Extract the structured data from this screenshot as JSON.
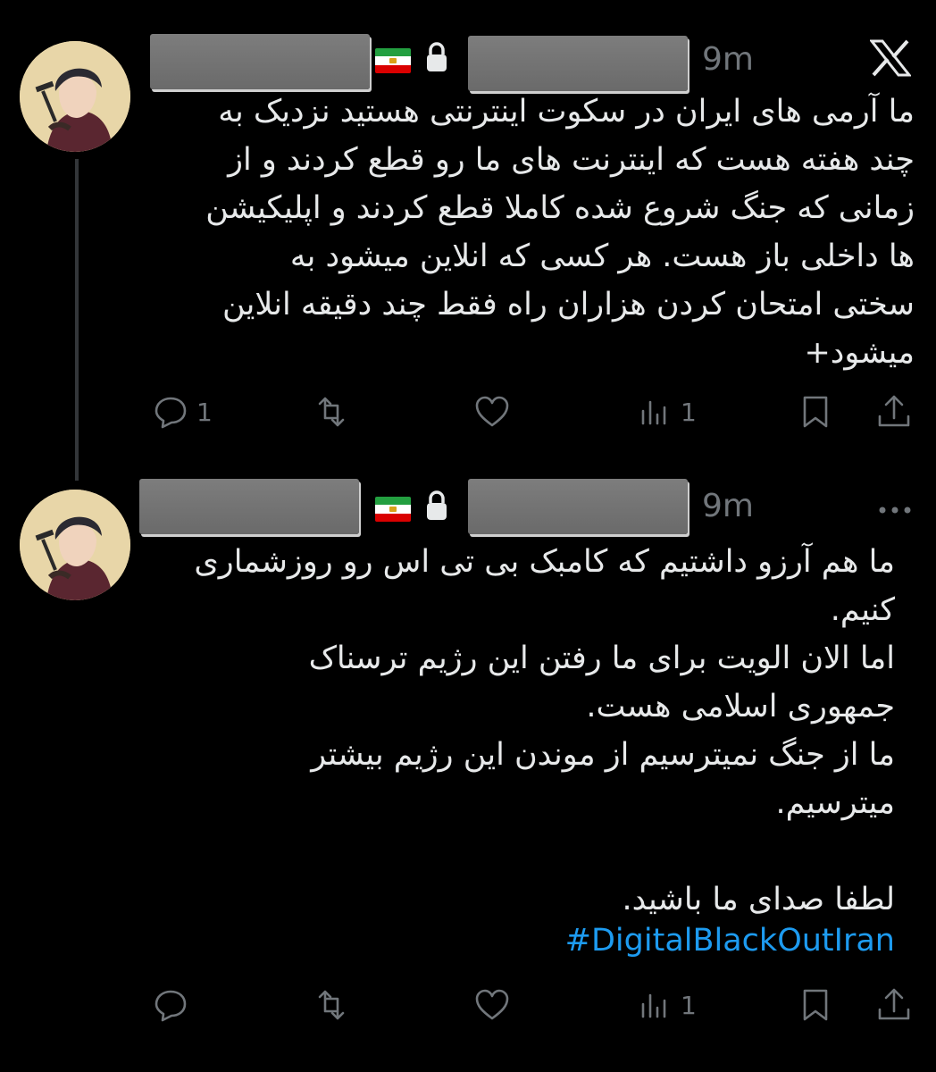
{
  "tweets": [
    {
      "time": "9m",
      "text": "ما آرمی های ایران در سکوت اینترنتی هستید نزدیک به\nچند هفته هست که اینترنت های ما رو قطع کردند و از\nزمانی که جنگ شروع شده کاملا قطع کردند و اپلیکیشن\nها داخلی باز هست.  هر کسی که انلاین میشود به\nسختی امتحان  کردن هزاران راه فقط چند دقیقه انلاین\nمیشود+",
      "hashtag": "",
      "replies": "1",
      "retweets": "",
      "likes": "",
      "views": "1"
    },
    {
      "time": "9m",
      "text": "ما هم آرزو داشتیم که کامبک بی تی اس رو روزشماری\nکنیم.\nاما الان  الویت برای ما رفتن این رژیم ترسناک\nجمهوری اسلامی هست.\nما از جنگ  نمیترسیم از موندن این رژیم بیشتر\nمیترسیم.\n\nلطفا صدای ما باشید.",
      "hashtag": "#DigitalBlackOutIran",
      "replies": "",
      "retweets": "",
      "likes": "",
      "views": "1"
    }
  ],
  "icons": {
    "close": "x-logo-icon",
    "more": "more-icon",
    "lock": "lock-icon",
    "flag": "iran-lion-sun-flag-icon"
  },
  "colors": {
    "background": "#000000",
    "text": "#e7e9ea",
    "muted": "#71767b",
    "link": "#1d9bf0"
  }
}
